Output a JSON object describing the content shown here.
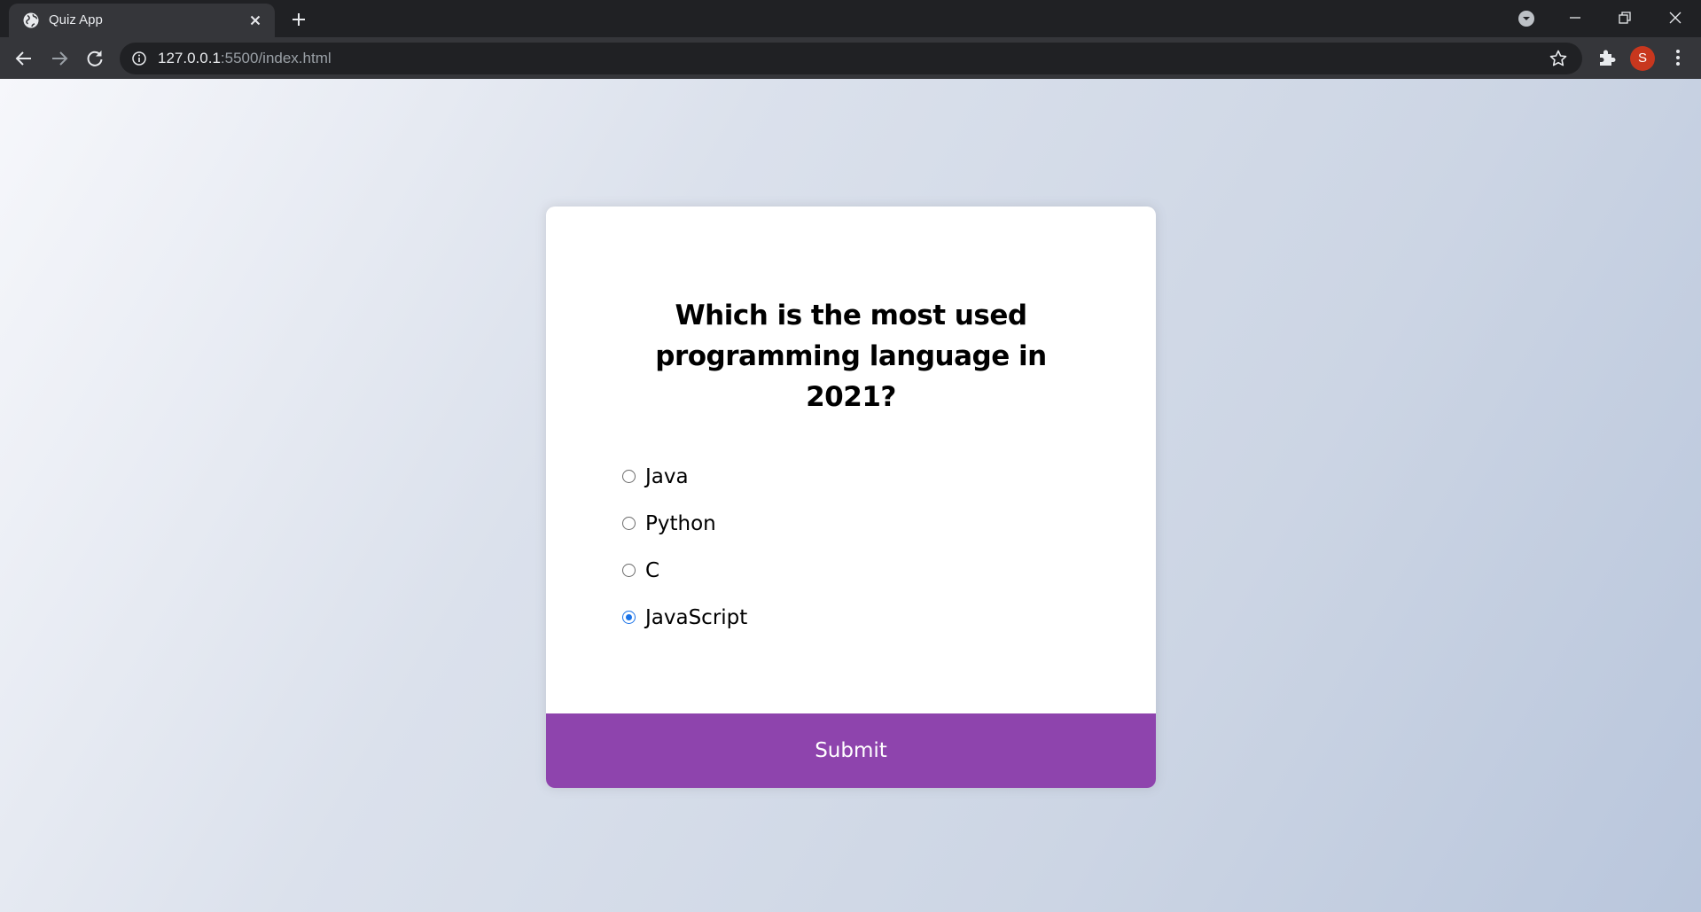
{
  "browser": {
    "tab_title": "Quiz App",
    "url_host": "127.0.0.1",
    "url_rest": ":5500/index.html",
    "profile_initial": "S",
    "icons": [
      "globe-icon",
      "close-icon",
      "plus-icon",
      "tab-search-icon",
      "minimize-icon",
      "restore-icon",
      "window-close-icon",
      "back-icon",
      "forward-icon",
      "reload-icon",
      "info-icon",
      "star-icon",
      "extensions-icon",
      "more-icon"
    ]
  },
  "quiz": {
    "question": "Which is the most used programming language in 2021?",
    "answers": [
      {
        "label": "Java",
        "selected": false
      },
      {
        "label": "Python",
        "selected": false
      },
      {
        "label": "C",
        "selected": false
      },
      {
        "label": "JavaScript",
        "selected": true
      }
    ],
    "submit_label": "Submit"
  },
  "colors": {
    "accent": "#8e44ad",
    "radio_selected": "#1a73e8",
    "browser_frame": "#202124",
    "toolbar": "#35363a",
    "avatar": "#c8371e"
  }
}
